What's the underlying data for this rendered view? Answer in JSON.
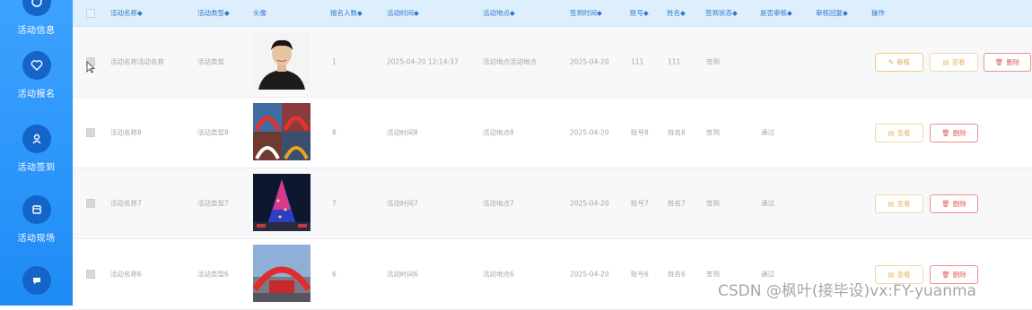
{
  "sidebar": {
    "items": [
      {
        "label": "活动信息",
        "icon": "info-icon"
      },
      {
        "label": "活动报名",
        "icon": "heart-icon"
      },
      {
        "label": "活动签到",
        "icon": "user-icon"
      },
      {
        "label": "活动现场",
        "icon": "calendar-icon"
      },
      {
        "label": "",
        "icon": "chat-icon"
      }
    ]
  },
  "table": {
    "headers": [
      "活动名称◆",
      "活动类型◆",
      "头像",
      "报名人数◆",
      "活动时间◆",
      "活动地点◆",
      "签到时间◆",
      "账号◆",
      "姓名◆",
      "签到状态◆",
      "是否审核◆",
      "审核回复◆",
      "操作"
    ],
    "rows": [
      {
        "name": "活动名称活动名称",
        "type": "活动类型",
        "count": "1",
        "time": "2025-04-20 12:14:37",
        "place": "活动地点活动地点",
        "sign_time": "2025-04-20",
        "account": "111",
        "person": "111",
        "status": "签到",
        "audit": "",
        "buttons": {
          "audit": "审核",
          "view": "查看",
          "delete": "删除"
        }
      },
      {
        "name": "活动名称8",
        "type": "活动类型8",
        "count": "8",
        "time": "活动时间8",
        "place": "活动地点8",
        "sign_time": "2025-04-20",
        "account": "账号8",
        "person": "姓名8",
        "status": "签到",
        "audit": "通过",
        "buttons": {
          "view": "查看",
          "delete": "删除"
        }
      },
      {
        "name": "活动名称7",
        "type": "活动类型7",
        "count": "7",
        "time": "活动时间7",
        "place": "活动地点7",
        "sign_time": "2025-04-20",
        "account": "账号7",
        "person": "姓名7",
        "status": "签到",
        "audit": "通过",
        "buttons": {
          "view": "查看",
          "delete": "删除"
        }
      },
      {
        "name": "活动名称6",
        "type": "活动类型6",
        "count": "6",
        "time": "活动时间6",
        "place": "活动地点6",
        "sign_time": "2025-04-20",
        "account": "账号6",
        "person": "姓名6",
        "status": "签到",
        "audit": "通过",
        "buttons": {
          "view": "查看",
          "delete": "删除"
        }
      }
    ]
  },
  "watermark": "CSDN @枫叶(接毕设)vx:FY-yuanma",
  "colors": {
    "sidebar": "#2a95fb",
    "header_bg": "#ddeefd",
    "audit": "#e7a84a",
    "delete": "#e35e5e"
  }
}
